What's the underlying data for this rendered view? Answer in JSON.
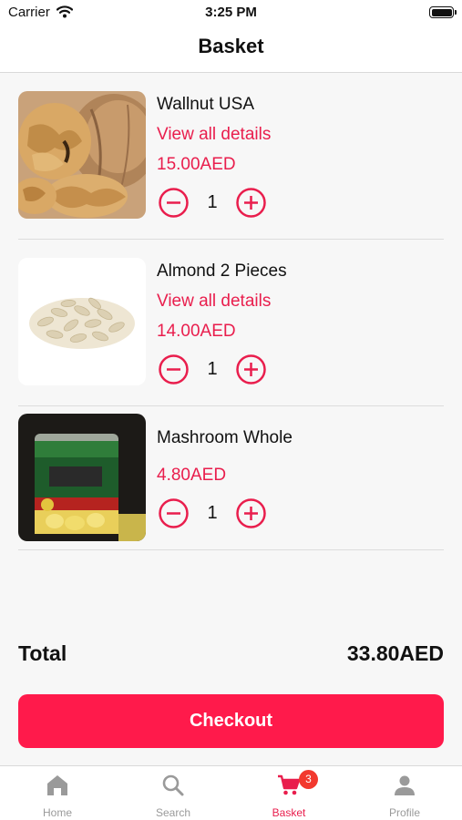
{
  "status_bar": {
    "carrier": "Carrier",
    "time": "3:25 PM"
  },
  "header": {
    "title": "Basket"
  },
  "items": [
    {
      "name": "Wallnut USA",
      "link": "View all details",
      "price": "15.00AED",
      "quantity": "1",
      "image_icon": "walnut-image"
    },
    {
      "name": "Almond 2 Pieces",
      "link": "View all details",
      "price": "14.00AED",
      "quantity": "1",
      "image_icon": "almond-image"
    },
    {
      "name": "Mashroom Whole",
      "price": "4.80AED",
      "quantity": "1",
      "image_icon": "mushroom-can-image"
    }
  ],
  "total": {
    "label": "Total",
    "value": "33.80AED"
  },
  "checkout": {
    "label": "Checkout"
  },
  "tabs": [
    {
      "label": "Home",
      "icon": "home-icon"
    },
    {
      "label": "Search",
      "icon": "search-icon"
    },
    {
      "label": "Basket",
      "icon": "cart-icon",
      "badge": "3",
      "active": true
    },
    {
      "label": "Profile",
      "icon": "profile-icon"
    }
  ],
  "colors": {
    "accent": "#e91e4d",
    "button": "#ff1a4b",
    "badge": "#f2392e",
    "inactive": "#9a9a9a"
  }
}
